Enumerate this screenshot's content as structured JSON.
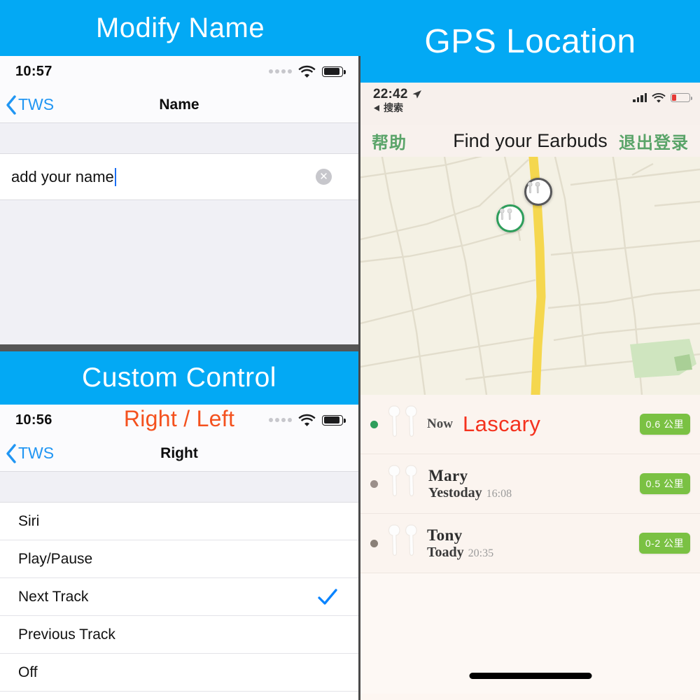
{
  "panels": {
    "modify_name": {
      "banner_title": "Modify Name",
      "status_bar": {
        "time": "10:57",
        "signal_icon": "signal-dots-icon",
        "wifi_icon": "wifi-icon",
        "battery_icon": "battery-full-icon"
      },
      "nav": {
        "back_label": "TWS",
        "back_icon": "chevron-left-icon",
        "title": "Name"
      },
      "field": {
        "value": "add your name",
        "placeholder": "add your name",
        "clear_icon": "clear-circle-icon"
      }
    },
    "custom_control": {
      "banner_title": "Custom Control",
      "status_bar": {
        "time": "10:56",
        "signal_icon": "signal-dots-icon",
        "wifi_icon": "wifi-icon",
        "battery_icon": "battery-full-icon"
      },
      "overlay_label": "Right / Left",
      "overlay_color": "#f4511e",
      "nav": {
        "back_label": "TWS",
        "back_icon": "chevron-left-icon",
        "title": "Right"
      },
      "options": [
        {
          "label": "Siri",
          "selected": false
        },
        {
          "label": "Play/Pause",
          "selected": false
        },
        {
          "label": "Next Track",
          "selected": true
        },
        {
          "label": "Previous Track",
          "selected": false
        },
        {
          "label": "Off",
          "selected": false
        }
      ],
      "check_icon": "checkmark-icon"
    },
    "gps_location": {
      "banner_title": "GPS Location",
      "status_bar": {
        "time": "22:42",
        "location_arrow_icon": "location-arrow-icon",
        "back_app_icon": "triangle-left-icon",
        "back_app_label": "搜索",
        "signal_icon": "signal-bars-icon",
        "wifi_icon": "wifi-icon",
        "battery_icon": "battery-low-icon"
      },
      "nav": {
        "left_label": "帮助",
        "title": "Find your Earbuds",
        "right_label": "退出登录",
        "side_color": "#5aa469"
      },
      "map": {
        "markers": [
          {
            "name": "earbuds-marker-road",
            "icon": "earbuds-icon",
            "ring": "#58585a"
          },
          {
            "name": "earbuds-marker-active",
            "icon": "earbuds-icon",
            "ring": "#2e9e5b"
          }
        ],
        "road_color": "#f5d74e",
        "park_color": "#cfe5bf",
        "land_color": "#f4f1e4"
      },
      "devices": [
        {
          "dot_color": "#2e9e5b",
          "icon": "earbuds-icon",
          "prefix": "Now",
          "name": "Lascary",
          "name_color": "#f4321e",
          "when": "",
          "time": "",
          "badge": "0.6 公里",
          "highlight": true
        },
        {
          "dot_color": "#9b8f8a",
          "icon": "earbuds-icon",
          "prefix": "",
          "name": "Mary",
          "name_color": "#2f2f2f",
          "when": "Yestoday",
          "time": "16:08",
          "badge": "0.5 公里",
          "highlight": false
        },
        {
          "dot_color": "#8a8078",
          "icon": "earbuds-icon",
          "prefix": "",
          "name": "Tony",
          "name_color": "#2f2f2f",
          "when": "Toady",
          "time": "20:35",
          "badge": "0-2 公里",
          "highlight": false
        }
      ],
      "badge_color": "#7ac143",
      "home_indicator": "home-indicator"
    }
  },
  "theme": {
    "banner_blue": "#03a9f4",
    "ios_blue": "#0a84ff",
    "divider_gray": "#555555"
  }
}
